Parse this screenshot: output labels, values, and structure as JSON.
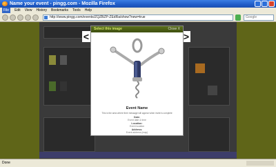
{
  "window": {
    "title": "Name your event - pingg.com - Mozilla Firefox"
  },
  "menu": [
    "File",
    "Edit",
    "View",
    "History",
    "Bookmarks",
    "Tools",
    "Help"
  ],
  "navigation": {
    "url": "http://www.pingg.com/events/ZQZBZP-ZEdRa/show?new=true",
    "search_placeholder": "Google"
  },
  "status": {
    "text": "Done"
  },
  "modal": {
    "header": "Select this image",
    "close_label": "Close X",
    "prev_label": "<",
    "next_label": ">",
    "event_name": "Event Name",
    "event_description": "This is the area where their message will appear when invite is complete",
    "date_label": "Date:",
    "date_value": "Event date & time",
    "location_label": "Location:",
    "location_value": "Event location",
    "address_label": "Address:",
    "address_value": "Event address (map)"
  },
  "colors": {
    "modal_header": "#4a5d16",
    "page_backdrop": "#8b8f2c"
  }
}
